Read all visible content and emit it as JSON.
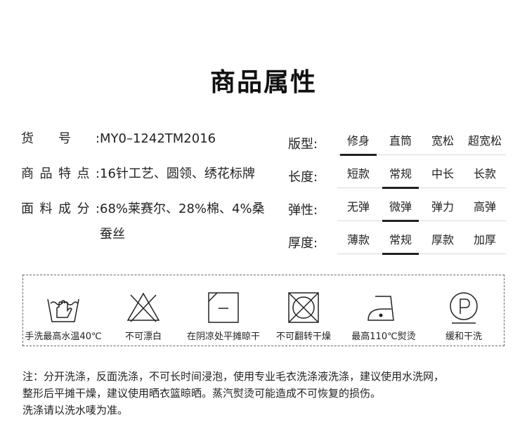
{
  "title": "商品属性",
  "info": [
    {
      "label": "货号:",
      "value": "MY0–1242TM2016"
    },
    {
      "label": "商品特点:",
      "value": "16针工艺、圆领、绣花标牌"
    },
    {
      "label": "面料成分:",
      "value": "68%莱赛尔、28%棉、4%桑蚕丝"
    }
  ],
  "attributes": [
    {
      "label": "版型:",
      "options": [
        "修身",
        "直筒",
        "宽松",
        "超宽松"
      ],
      "selected": 0
    },
    {
      "label": "长度:",
      "options": [
        "短款",
        "常规",
        "中长",
        "长款"
      ],
      "selected": 1
    },
    {
      "label": "弹性:",
      "options": [
        "无弹",
        "微弹",
        "弹力",
        "高弹"
      ],
      "selected": 1
    },
    {
      "label": "厚度:",
      "options": [
        "薄款",
        "常规",
        "厚款",
        "加厚"
      ],
      "selected": 1
    }
  ],
  "care": [
    {
      "icon": "hand-wash-icon",
      "label": "手洗最高水温40℃"
    },
    {
      "icon": "no-bleach-icon",
      "label": "不可漂白"
    },
    {
      "icon": "shade-dry-flat-icon",
      "label": "在阴凉处平摊晾干"
    },
    {
      "icon": "no-tumble-dry-icon",
      "label": "不可翻转干燥"
    },
    {
      "icon": "iron-110-icon",
      "label": "最高110℃熨烫"
    },
    {
      "icon": "gentle-dry-clean-icon",
      "label": "缓和干洗"
    }
  ],
  "note": {
    "line1": "注：分开洗涤，反面洗涤，不可长时间浸泡，使用专业毛衣洗涤液洗涤，建议使用水洗网，",
    "line2": "整形后平摊干燥，建议使用晒衣篮晾晒。蒸汽熨烫可能造成不可恢复的损伤。",
    "line3": "洗涤请以洗水唛为准。"
  }
}
